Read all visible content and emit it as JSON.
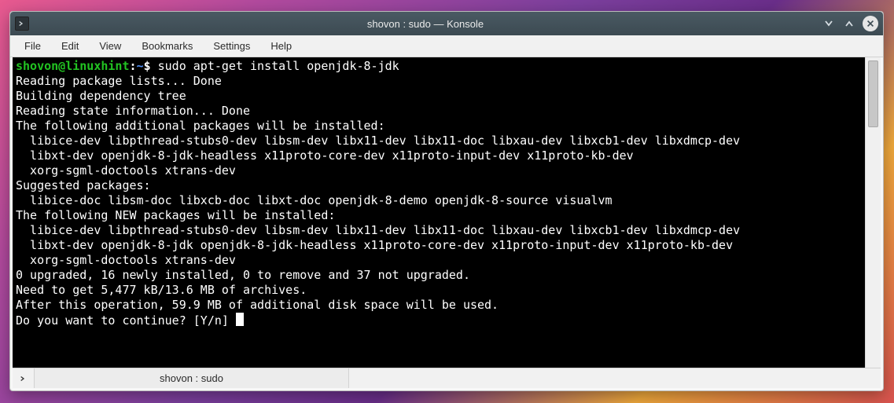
{
  "titlebar": {
    "title": "shovon : sudo — Konsole"
  },
  "menubar": {
    "items": [
      {
        "label": "File"
      },
      {
        "label": "Edit"
      },
      {
        "label": "View"
      },
      {
        "label": "Bookmarks"
      },
      {
        "label": "Settings"
      },
      {
        "label": "Help"
      }
    ]
  },
  "terminal": {
    "prompt": {
      "user_host": "shovon@linuxhint",
      "colon": ":",
      "path": "~",
      "dollar": "$",
      "command": " sudo apt-get install openjdk-8-jdk"
    },
    "lines": [
      "Reading package lists... Done",
      "Building dependency tree       ",
      "Reading state information... Done",
      "The following additional packages will be installed:",
      "  libice-dev libpthread-stubs0-dev libsm-dev libx11-dev libx11-doc libxau-dev libxcb1-dev libxdmcp-dev",
      "  libxt-dev openjdk-8-jdk-headless x11proto-core-dev x11proto-input-dev x11proto-kb-dev",
      "  xorg-sgml-doctools xtrans-dev",
      "Suggested packages:",
      "  libice-doc libsm-doc libxcb-doc libxt-doc openjdk-8-demo openjdk-8-source visualvm",
      "The following NEW packages will be installed:",
      "  libice-dev libpthread-stubs0-dev libsm-dev libx11-dev libx11-doc libxau-dev libxcb1-dev libxdmcp-dev",
      "  libxt-dev openjdk-8-jdk openjdk-8-jdk-headless x11proto-core-dev x11proto-input-dev x11proto-kb-dev",
      "  xorg-sgml-doctools xtrans-dev",
      "0 upgraded, 16 newly installed, 0 to remove and 37 not upgraded.",
      "Need to get 5,477 kB/13.6 MB of archives.",
      "After this operation, 59.9 MB of additional disk space will be used.",
      "Do you want to continue? [Y/n] "
    ]
  },
  "tabbar": {
    "tab_label": "shovon : sudo"
  }
}
